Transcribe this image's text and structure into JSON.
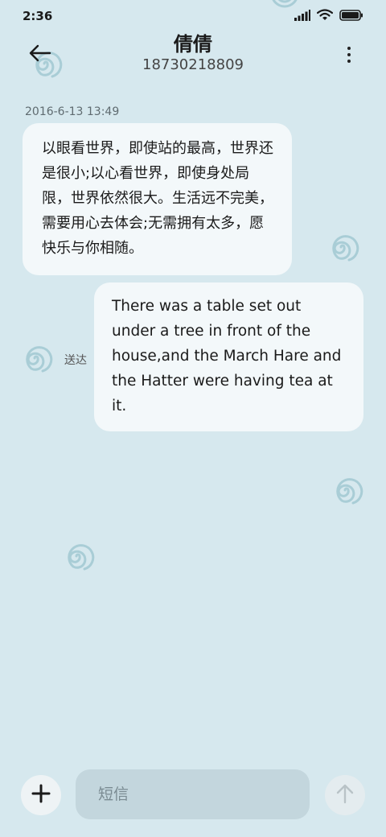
{
  "status_bar": {
    "time": "2:36",
    "icons": [
      "signal-icon",
      "wifi-icon",
      "battery-icon"
    ]
  },
  "header": {
    "contact_name": "倩倩",
    "contact_number": "18730218809",
    "back_icon": "arrow-left-icon",
    "more_icon": "more-vertical-icon"
  },
  "messages": {
    "timestamp": "2016-6-13 13:49",
    "incoming_text": "以眼看世界，即使站的最高，世界还是很小;以心看世界，即使身处局限，世界依然很大。生活远不完美，需要用心去体会;无需拥有太多，愿快乐与你相随。",
    "outgoing_text": "There was a table set out under a tree in front of the house,and the March Hare and the Hatter were having tea at it.",
    "delivery_status": "送达"
  },
  "composer": {
    "placeholder": "短信",
    "add_icon": "plus-icon",
    "send_icon": "arrow-up-icon"
  },
  "colors": {
    "background": "#d6e8ee",
    "bubble": "#f3f8fa",
    "swirl": "#a9cdd6",
    "input": "#c3d6dd"
  }
}
